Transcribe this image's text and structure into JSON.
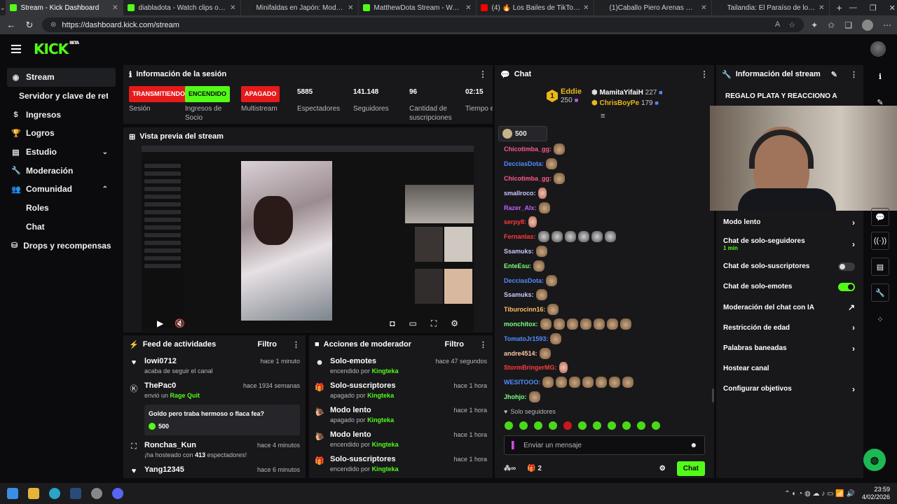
{
  "browser": {
    "tabs": [
      {
        "title": "Stream - Kick Dashboard",
        "color": "#53fc18",
        "active": true
      },
      {
        "title": "diabladota - Watch clips on Kick",
        "color": "#53fc18",
        "active": false
      },
      {
        "title": "Minifaldas en Japón: Moda y Cult",
        "color": "#222222",
        "active": false
      },
      {
        "title": "MatthewDota Stream - Watch Liv",
        "color": "#53fc18",
        "active": false
      },
      {
        "title": "(4) 🔥 Los Bailes de TikTok Más V",
        "color": "#ff0000",
        "active": false
      },
      {
        "title": "(1)Caballo Piero Arenas @pieroar",
        "color": "#222222",
        "active": false
      },
      {
        "title": "Tailandia: El Paraíso de los Jubilac",
        "color": "#222222",
        "active": false
      }
    ],
    "url": "https://dashboard.kick.com/stream"
  },
  "header": {
    "logo": "KICK",
    "beta": "BETA"
  },
  "sidebar": {
    "items": [
      {
        "label": "Stream",
        "icon": "stream-icon"
      },
      {
        "label": "Servidor y clave de retransmisión"
      },
      {
        "label": "Ingresos",
        "icon": "dollar-icon"
      },
      {
        "label": "Logros",
        "icon": "trophy-icon"
      },
      {
        "label": "Estudio",
        "icon": "studio-icon"
      },
      {
        "label": "Moderación",
        "icon": "wrench-icon"
      },
      {
        "label": "Comunidad",
        "icon": "community-icon"
      },
      {
        "label": "Roles"
      },
      {
        "label": "Chat"
      },
      {
        "label": "Drops y recompensas",
        "icon": "drops-icon"
      }
    ]
  },
  "session": {
    "title": "Información de la sesión",
    "columns": [
      {
        "value": "TRANSMITIENDO",
        "label": "Sesión",
        "kind": "red"
      },
      {
        "value": "ENCENDIDO",
        "label": "Ingresos de Socio",
        "kind": "green"
      },
      {
        "value": "APAGADO",
        "label": "Multistream",
        "kind": "red"
      },
      {
        "value": "5885",
        "label": "Espectadores",
        "kind": "text"
      },
      {
        "value": "141.148",
        "label": "Seguidores",
        "kind": "text"
      },
      {
        "value": "96",
        "label": "Cantidad de suscripciones",
        "kind": "text"
      },
      {
        "value": "02:15",
        "label": "Tiempo en vivo",
        "kind": "text"
      }
    ]
  },
  "preview": {
    "title": "Vista previa del stream"
  },
  "feed": {
    "title": "Feed de actividades",
    "filter": "Filtro",
    "items": [
      {
        "name": "lowi0712",
        "time": "hace 1 minuto",
        "sub": "acaba de seguir el canal",
        "icon": "heart-icon"
      },
      {
        "name": "ThePac0",
        "time": "hace 1934 semanas",
        "sub_pre": "envió un",
        "sub_hl": "Rage Quit",
        "box_text": "Goldo pero traba hermoso o flaca fea?",
        "box_amount": "500",
        "icon": "kick-icon"
      },
      {
        "name": "Ronchas_Kun",
        "time": "hace 4 minutos",
        "sub_pre": "¡ha hosteado con",
        "sub_num": "413",
        "sub_post": "espectadores!",
        "icon": "host-icon"
      },
      {
        "name": "Yang12345",
        "time": "hace 6 minutos",
        "icon": "heart-icon"
      }
    ]
  },
  "modactions": {
    "title": "Acciones de moderador",
    "filter": "Filtro",
    "items": [
      {
        "name": "Solo-emotes",
        "time": "hace 47 segundos",
        "state": "encendido por",
        "by": "Kingteka",
        "icon": "emote-icon"
      },
      {
        "name": "Solo-suscriptores",
        "time": "hace 1 hora",
        "state": "apagado por",
        "by": "Kingteka",
        "icon": "gift-icon"
      },
      {
        "name": "Modo lento",
        "time": "hace 1 hora",
        "state": "apagado por",
        "by": "Kingteka",
        "icon": "snail-icon"
      },
      {
        "name": "Modo lento",
        "time": "hace 1 hora",
        "state": "encendido por",
        "by": "Kingteka",
        "icon": "snail-icon"
      },
      {
        "name": "Solo-suscriptores",
        "time": "hace 1 hora",
        "state": "encendido por",
        "by": "Kingteka",
        "icon": "gift-icon"
      }
    ]
  },
  "chat": {
    "title": "Chat",
    "leaders": [
      {
        "name": "Eddie",
        "value": "250"
      },
      {
        "name": "MamitaYifaiH",
        "value": "227"
      },
      {
        "name": "ChrisBoyPe",
        "value": "179"
      }
    ],
    "pinned_value": "500",
    "messages": [
      {
        "user": "Chicotimba_gg:",
        "color": "#ff5a8a",
        "emotes": 1,
        "kind": "brown"
      },
      {
        "user": "DecciasDota:",
        "color": "#4f8dff",
        "emotes": 1,
        "kind": "brown"
      },
      {
        "user": "Chicotimba_gg:",
        "color": "#ff5a8a",
        "emotes": 1,
        "kind": "brown"
      },
      {
        "user": "smallroco:",
        "color": "#c9c9ff",
        "emotes": 1,
        "kind": "pink"
      },
      {
        "user": "Razer_Alx:",
        "color": "#c060ff",
        "emotes": 1,
        "kind": "brown"
      },
      {
        "user": "serpy8:",
        "color": "#ff3a3a",
        "emotes": 1,
        "kind": "pink"
      },
      {
        "user": "Fernanlas:",
        "color": "#ff3a3a",
        "emotes": 6,
        "kind": "grey"
      },
      {
        "user": "Ssamuks:",
        "color": "#c9c9ff",
        "emotes": 1,
        "kind": "brown"
      },
      {
        "user": "EnteEsu:",
        "color": "#7cff7c",
        "emotes": 1,
        "kind": "brown"
      },
      {
        "user": "DecciasDota:",
        "color": "#4f8dff",
        "emotes": 1,
        "kind": "brown"
      },
      {
        "user": "Ssamuks:",
        "color": "#c9c9ff",
        "emotes": 1,
        "kind": "brown"
      },
      {
        "user": "Tiburocinn16:",
        "color": "#ffc060",
        "emotes": 1,
        "kind": "brown"
      },
      {
        "user": "monchitox:",
        "color": "#7cff7c",
        "emotes": 7,
        "kind": "brown"
      },
      {
        "user": "TomatoJr1593:",
        "color": "#4f8dff",
        "emotes": 1,
        "kind": "brown"
      },
      {
        "user": "andre4514:",
        "color": "#ffc9a0",
        "emotes": 1,
        "kind": "brown"
      },
      {
        "user": "StormBringerMG:",
        "color": "#ff3a3a",
        "emotes": 1,
        "kind": "pink"
      },
      {
        "user": "WESITOOO:",
        "color": "#4f8dff",
        "emotes": 7,
        "kind": "brown"
      },
      {
        "user": "Jhohjo:",
        "color": "#7cff7c",
        "emotes": 1,
        "kind": "brown"
      }
    ],
    "follow_only": "Solo seguidores",
    "input_placeholder": "Enviar un mensaje",
    "gift_count": "2",
    "send_label": "Chat"
  },
  "streaminfo": {
    "title": "Información del stream",
    "stream_title": "REGALO PLATA Y REACCIONO A CLIPS VEN",
    "settings": [
      {
        "label": "Modo lento",
        "type": "arrow"
      },
      {
        "label": "Chat de solo-seguidores",
        "sub": "1 min",
        "type": "arrow"
      },
      {
        "label": "Chat de solo-suscriptores",
        "type": "toggle",
        "on": false
      },
      {
        "label": "Chat de solo-emotes",
        "type": "toggle",
        "on": true
      },
      {
        "label": "Moderación del chat con IA",
        "type": "external"
      },
      {
        "label": "Restricción de edad",
        "type": "arrow"
      },
      {
        "label": "Palabras baneadas",
        "type": "arrow"
      },
      {
        "label": "Hostear canal",
        "type": "none"
      },
      {
        "label": "Configurar objetivos",
        "type": "arrow"
      }
    ]
  },
  "taskbar": {
    "time": "23:59",
    "date": "4/02/2026"
  },
  "colors": {
    "accent": "#53fc18",
    "live_red": "#e61a1a",
    "panel": "#18181b",
    "bg": "#0b0b0d"
  }
}
